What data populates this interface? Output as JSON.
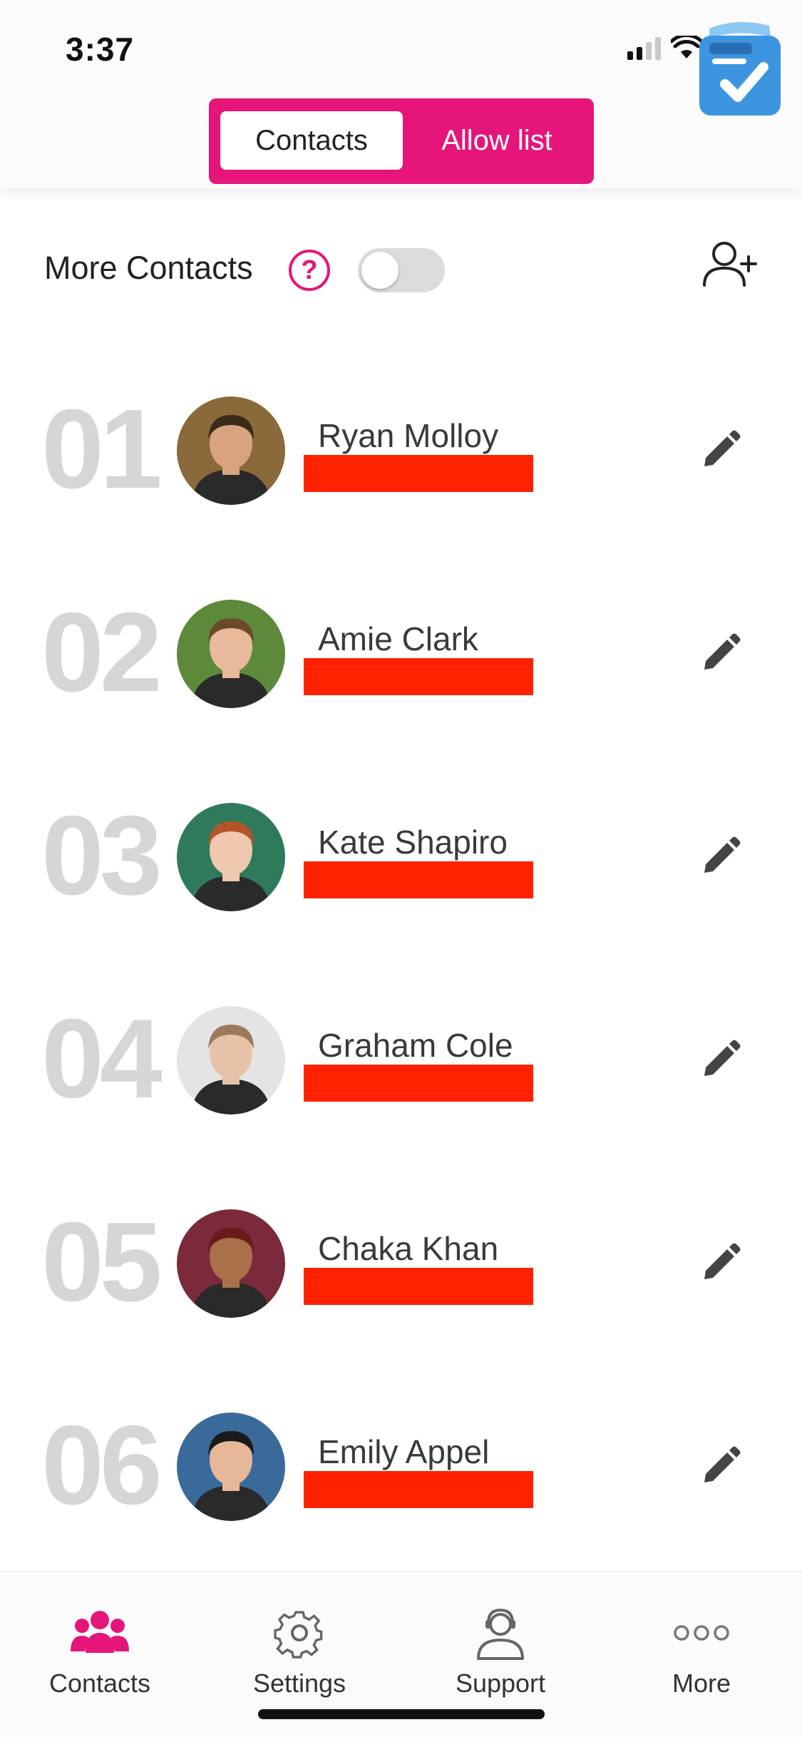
{
  "status_bar": {
    "time": "3:37"
  },
  "tabs": {
    "contacts": "Contacts",
    "allow_list": "Allow list",
    "active": "contacts"
  },
  "more_contacts": {
    "label": "More Contacts",
    "help": "?",
    "enabled": false
  },
  "contacts": [
    {
      "number": "01",
      "name": "Ryan  Molloy",
      "avatar_bg": "#8a6a3a",
      "avatar_skin": "#d9a37f",
      "avatar_hair": "#3a2a1a"
    },
    {
      "number": "02",
      "name": "Amie Clark",
      "avatar_bg": "#5c8a3a",
      "avatar_skin": "#e8b99a",
      "avatar_hair": "#6a4a2a"
    },
    {
      "number": "03",
      "name": "Kate  Shapiro",
      "avatar_bg": "#2f7a5a",
      "avatar_skin": "#f0c8b0",
      "avatar_hair": "#b5532a"
    },
    {
      "number": "04",
      "name": "Graham Cole",
      "avatar_bg": "#e4e4e4",
      "avatar_skin": "#e6c3a8",
      "avatar_hair": "#9a7a5a"
    },
    {
      "number": "05",
      "name": "Chaka Khan",
      "avatar_bg": "#7a2a3a",
      "avatar_skin": "#a9704a",
      "avatar_hair": "#6a1a1a"
    },
    {
      "number": "06",
      "name": "Emily Appel",
      "avatar_bg": "#3a6a9a",
      "avatar_skin": "#e6b899",
      "avatar_hair": "#1a1a1a"
    }
  ],
  "nav": {
    "contacts": "Contacts",
    "settings": "Settings",
    "support": "Support",
    "more": "More",
    "active": "contacts"
  },
  "colors": {
    "accent": "#e6157a",
    "redaction": "#ff2200",
    "number_gray": "#d6d6d6"
  }
}
